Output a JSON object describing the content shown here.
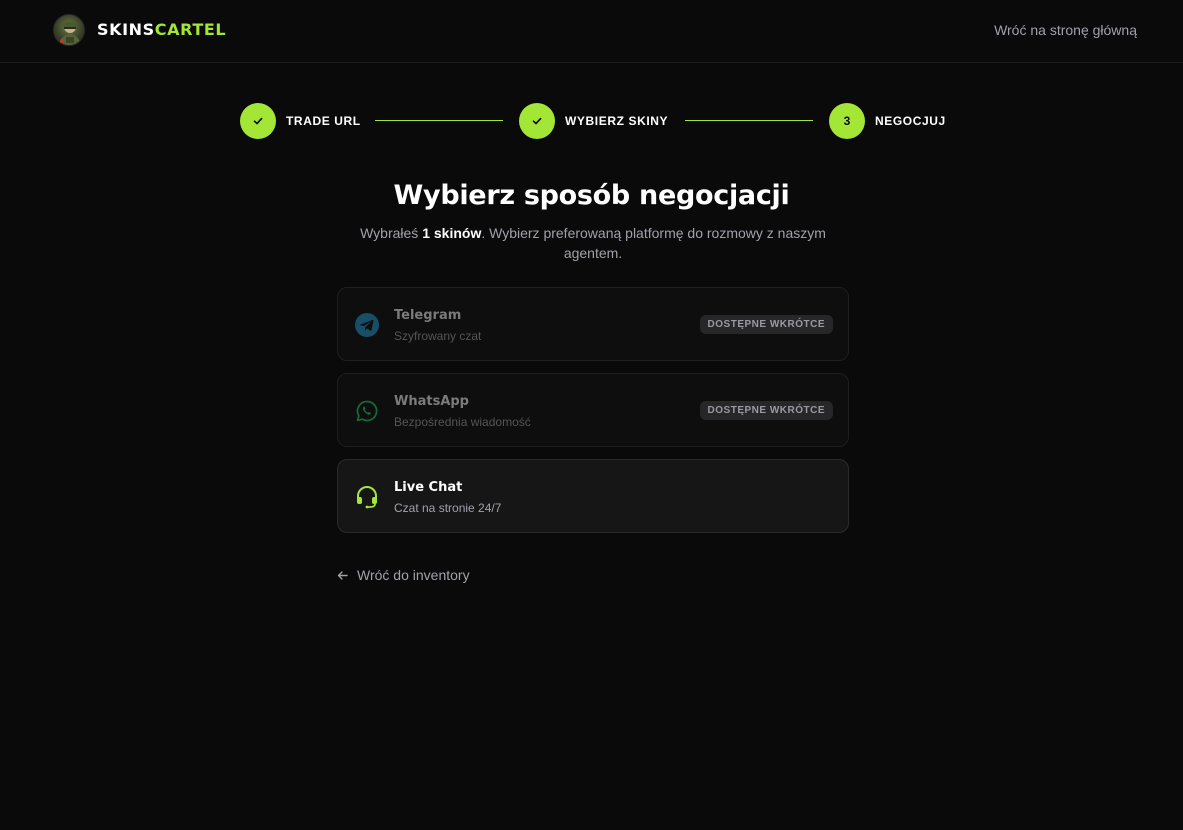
{
  "header": {
    "brand_part1": "SKINS",
    "brand_part2": "CARTEL",
    "home_link": "Wróć na stronę główną"
  },
  "stepper": {
    "steps": [
      {
        "label": "TRADE URL",
        "state": "done",
        "icon": "check-icon"
      },
      {
        "label": "WYBIERZ SKINY",
        "state": "done",
        "icon": "check-icon"
      },
      {
        "label": "NEGOCJUJ",
        "state": "current",
        "number": "3"
      }
    ]
  },
  "main": {
    "title": "Wybierz sposób negocjacji",
    "subtitle_prefix": "Wybrałeś ",
    "subtitle_count": "1 skinów",
    "subtitle_suffix": ". Wybierz preferowaną platformę do rozmowy z naszym agentem.",
    "options": [
      {
        "title": "Telegram",
        "subtitle": "Szyfrowany czat",
        "badge": "DOSTĘPNE WKRÓTCE",
        "icon": "telegram-icon",
        "enabled": false
      },
      {
        "title": "WhatsApp",
        "subtitle": "Bezpośrednia wiadomość",
        "badge": "DOSTĘPNE WKRÓTCE",
        "icon": "whatsapp-icon",
        "enabled": false
      },
      {
        "title": "Live Chat",
        "subtitle": "Czat na stronie 24/7",
        "icon": "headset-icon",
        "enabled": true
      }
    ],
    "back_link": "Wróć do inventory"
  },
  "colors": {
    "background": "#0a0a0a",
    "accent": "#a3e635",
    "muted_text": "#a1a1aa",
    "telegram": "#229ED9",
    "whatsapp": "#25D366"
  }
}
